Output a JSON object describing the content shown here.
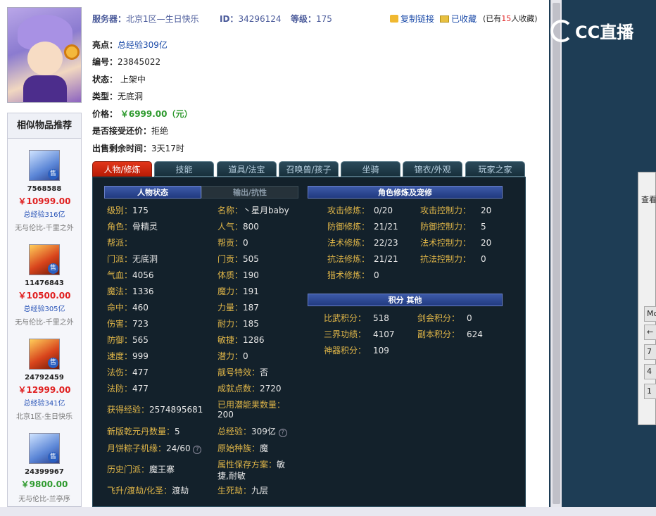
{
  "topbar": {
    "server_label": "服务器：",
    "server_value": "北京1区—生日快乐",
    "id_label": "ID：",
    "id_value": "34296124",
    "level_label": "等级：",
    "level_value": "175",
    "copy_link": "复制链接",
    "favorited": "已收藏",
    "fav_prefix": "(已有",
    "fav_count": "15",
    "fav_suffix": "人收藏)"
  },
  "info": {
    "highlight_label": "亮点：",
    "highlight_value": "总经验309亿",
    "serial_label": "编号：",
    "serial_value": "23845022",
    "status_label": "状态：",
    "status_value": "上架中",
    "type_label": "类型：",
    "type_value": "无底洞",
    "price_label": "价格：",
    "price_value": "￥6999.00（元）",
    "counter_label": "是否接受还价：",
    "counter_value": "拒绝",
    "remaining_label": "出售剩余时间：",
    "remaining_value": "3天17时"
  },
  "tabs": [
    "人物/修炼",
    "技能",
    "道具/法宝",
    "召唤兽/孩子",
    "坐骑",
    "锦衣/外观",
    "玩家之家"
  ],
  "panel": {
    "hdr_char": "人物状态",
    "hdr_output": "输出/抗性",
    "hdr_cult": "角色修炼及宠修",
    "hdr_points": "积分 其他",
    "left_col": [
      {
        "label": "级别：",
        "value": "175"
      },
      {
        "label": "角色：",
        "value": "骨精灵"
      },
      {
        "label": "帮派：",
        "value": ""
      },
      {
        "label": "门派：",
        "value": "无底洞"
      },
      {
        "label": "气血：",
        "value": "4056"
      },
      {
        "label": "魔法：",
        "value": "1336"
      },
      {
        "label": "命中：",
        "value": "460"
      },
      {
        "label": "伤害：",
        "value": "723"
      },
      {
        "label": "防御：",
        "value": "565"
      },
      {
        "label": "速度：",
        "value": "999"
      },
      {
        "label": "法伤：",
        "value": "477"
      },
      {
        "label": "法防：",
        "value": "477"
      }
    ],
    "mid_col": [
      {
        "label": "名称：",
        "value": "丶星月baby"
      },
      {
        "label": "人气：",
        "value": "800"
      },
      {
        "label": "帮贡：",
        "value": "0"
      },
      {
        "label": "门贡：",
        "value": "505"
      },
      {
        "label": "体质：",
        "value": "190"
      },
      {
        "label": "魔力：",
        "value": "191"
      },
      {
        "label": "力量：",
        "value": "187"
      },
      {
        "label": "耐力：",
        "value": "185"
      },
      {
        "label": "敏捷：",
        "value": "1286"
      },
      {
        "label": "潜力：",
        "value": "0"
      },
      {
        "label": "靓号特效：",
        "value": "否"
      },
      {
        "label": "成就点数：",
        "value": "2720"
      }
    ],
    "exp_label": "获得经验：",
    "exp_value": "2574895681",
    "used_potential_label": "已用潜能果数量：",
    "used_potential_value": "200",
    "qiankun_label": "新版乾元丹数量：",
    "qiankun_value": "5",
    "total_exp_label": "总经验：",
    "total_exp_value": "309亿",
    "zongzi_label": "月饼粽子机缘：",
    "zongzi_value": "24/60",
    "origin_race_label": "原始种族：",
    "origin_race_value": "魔",
    "history_label": "历史门派：",
    "history_value": "魔王寨",
    "attr_save_label": "属性保存方案：",
    "attr_save_value1": "敏",
    "attr_save_value2": "捷,耐敏",
    "ascend_label": "飞升/渡劫/化圣：",
    "ascend_value": "渡劫",
    "life_label": "生死劫：",
    "life_value": "九层",
    "cult": [
      {
        "label": "攻击修炼：",
        "value": "0/20",
        "label2": "攻击控制力：",
        "value2": "20"
      },
      {
        "label": "防御修炼：",
        "value": "21/21",
        "label2": "防御控制力：",
        "value2": "5"
      },
      {
        "label": "法术修炼：",
        "value": "22/23",
        "label2": "法术控制力：",
        "value2": "20"
      },
      {
        "label": "抗法修炼：",
        "value": "21/21",
        "label2": "抗法控制力：",
        "value2": "0"
      },
      {
        "label": "猎术修炼：",
        "value": "0",
        "label2": "",
        "value2": ""
      }
    ],
    "points": [
      {
        "label": "比武积分：",
        "value": "518",
        "label2": "剑会积分：",
        "value2": "0"
      },
      {
        "label": "三界功绩：",
        "value": "4107",
        "label2": "副本积分：",
        "value2": "624"
      },
      {
        "label": "神器积分：",
        "value": "109",
        "label2": "",
        "value2": ""
      }
    ]
  },
  "recommend": {
    "title": "相似物品推荐",
    "tag": "售",
    "items": [
      {
        "id": "7568588",
        "price": "￥10999.00",
        "exp": "总经验316亿",
        "server": "无与伦比-千里之外"
      },
      {
        "id": "11476843",
        "price": "￥10500.00",
        "exp": "总经验305亿",
        "server": "无与伦比-千里之外"
      },
      {
        "id": "24792459",
        "price": "￥12999.00",
        "exp": "总经验341亿",
        "server": "北京1区-生日快乐"
      },
      {
        "id": "24399967",
        "price": "￥9800.00",
        "exp": "",
        "server": "无与伦比-兰亭序"
      }
    ]
  },
  "overlay": {
    "logo_text": "CC直播",
    "dialog_label": "查看",
    "dialog_btns": [
      "Mc",
      "←",
      "7",
      "4",
      "1"
    ]
  },
  "colors": {
    "price_green": "#2e9a2e",
    "price_red": "#e02020",
    "panel_bg": "#13212b",
    "label_gold": "#e0b648",
    "tab_active": "#d02a10"
  }
}
